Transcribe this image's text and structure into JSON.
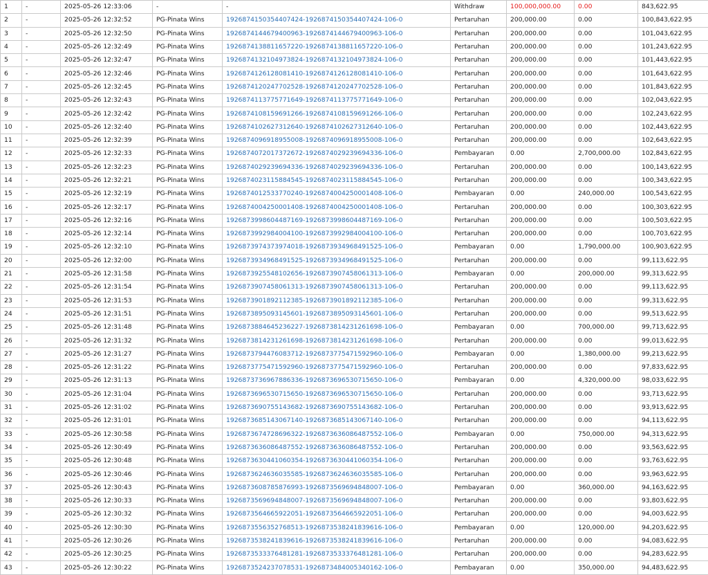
{
  "colors": {
    "link": "#2a6fb5",
    "red": "#e51616",
    "grid": "#c9c9c9"
  },
  "rows": [
    {
      "no": "1",
      "col2": "-",
      "date": "2025-05-26 12:33:06",
      "game": "-",
      "ref": "-",
      "type": "Withdraw",
      "debit": "100,000,000.00",
      "credit": "0.00",
      "balance": "843,622.95",
      "red": true
    },
    {
      "no": "2",
      "col2": "-",
      "date": "2025-05-26 12:32:52",
      "game": "PG-Pinata Wins",
      "ref": "1926874150354407424-1926874150354407424-106-0",
      "type": "Pertaruhan",
      "debit": "200,000.00",
      "credit": "0.00",
      "balance": "100,843,622.95"
    },
    {
      "no": "3",
      "col2": "-",
      "date": "2025-05-26 12:32:50",
      "game": "PG-Pinata Wins",
      "ref": "1926874144679400963-1926874144679400963-106-0",
      "type": "Pertaruhan",
      "debit": "200,000.00",
      "credit": "0.00",
      "balance": "101,043,622.95"
    },
    {
      "no": "4",
      "col2": "-",
      "date": "2025-05-26 12:32:49",
      "game": "PG-Pinata Wins",
      "ref": "1926874138811657220-1926874138811657220-106-0",
      "type": "Pertaruhan",
      "debit": "200,000.00",
      "credit": "0.00",
      "balance": "101,243,622.95"
    },
    {
      "no": "5",
      "col2": "-",
      "date": "2025-05-26 12:32:47",
      "game": "PG-Pinata Wins",
      "ref": "1926874132104973824-1926874132104973824-106-0",
      "type": "Pertaruhan",
      "debit": "200,000.00",
      "credit": "0.00",
      "balance": "101,443,622.95"
    },
    {
      "no": "6",
      "col2": "-",
      "date": "2025-05-26 12:32:46",
      "game": "PG-Pinata Wins",
      "ref": "1926874126128081410-1926874126128081410-106-0",
      "type": "Pertaruhan",
      "debit": "200,000.00",
      "credit": "0.00",
      "balance": "101,643,622.95"
    },
    {
      "no": "7",
      "col2": "-",
      "date": "2025-05-26 12:32:45",
      "game": "PG-Pinata Wins",
      "ref": "1926874120247702528-1926874120247702528-106-0",
      "type": "Pertaruhan",
      "debit": "200,000.00",
      "credit": "0.00",
      "balance": "101,843,622.95"
    },
    {
      "no": "8",
      "col2": "-",
      "date": "2025-05-26 12:32:43",
      "game": "PG-Pinata Wins",
      "ref": "1926874113775771649-1926874113775771649-106-0",
      "type": "Pertaruhan",
      "debit": "200,000.00",
      "credit": "0.00",
      "balance": "102,043,622.95"
    },
    {
      "no": "9",
      "col2": "-",
      "date": "2025-05-26 12:32:42",
      "game": "PG-Pinata Wins",
      "ref": "1926874108159691266-1926874108159691266-106-0",
      "type": "Pertaruhan",
      "debit": "200,000.00",
      "credit": "0.00",
      "balance": "102,243,622.95"
    },
    {
      "no": "10",
      "col2": "-",
      "date": "2025-05-26 12:32:40",
      "game": "PG-Pinata Wins",
      "ref": "1926874102627312640-1926874102627312640-106-0",
      "type": "Pertaruhan",
      "debit": "200,000.00",
      "credit": "0.00",
      "balance": "102,443,622.95"
    },
    {
      "no": "11",
      "col2": "-",
      "date": "2025-05-26 12:32:39",
      "game": "PG-Pinata Wins",
      "ref": "1926874096918955008-1926874096918955008-106-0",
      "type": "Pertaruhan",
      "debit": "200,000.00",
      "credit": "0.00",
      "balance": "102,643,622.95"
    },
    {
      "no": "12",
      "col2": "-",
      "date": "2025-05-26 12:32:33",
      "game": "PG-Pinata Wins",
      "ref": "1926874072017372672-1926874029239694336-106-0",
      "type": "Pembayaran",
      "debit": "0.00",
      "credit": "2,700,000.00",
      "balance": "102,843,622.95"
    },
    {
      "no": "13",
      "col2": "-",
      "date": "2025-05-26 12:32:23",
      "game": "PG-Pinata Wins",
      "ref": "1926874029239694336-1926874029239694336-106-0",
      "type": "Pertaruhan",
      "debit": "200,000.00",
      "credit": "0.00",
      "balance": "100,143,622.95"
    },
    {
      "no": "14",
      "col2": "-",
      "date": "2025-05-26 12:32:21",
      "game": "PG-Pinata Wins",
      "ref": "1926874023115884545-1926874023115884545-106-0",
      "type": "Pertaruhan",
      "debit": "200,000.00",
      "credit": "0.00",
      "balance": "100,343,622.95"
    },
    {
      "no": "15",
      "col2": "-",
      "date": "2025-05-26 12:32:19",
      "game": "PG-Pinata Wins",
      "ref": "1926874012533770240-1926874004250001408-106-0",
      "type": "Pembayaran",
      "debit": "0.00",
      "credit": "240,000.00",
      "balance": "100,543,622.95"
    },
    {
      "no": "16",
      "col2": "-",
      "date": "2025-05-26 12:32:17",
      "game": "PG-Pinata Wins",
      "ref": "1926874004250001408-1926874004250001408-106-0",
      "type": "Pertaruhan",
      "debit": "200,000.00",
      "credit": "0.00",
      "balance": "100,303,622.95"
    },
    {
      "no": "17",
      "col2": "-",
      "date": "2025-05-26 12:32:16",
      "game": "PG-Pinata Wins",
      "ref": "1926873998604487169-1926873998604487169-106-0",
      "type": "Pertaruhan",
      "debit": "200,000.00",
      "credit": "0.00",
      "balance": "100,503,622.95"
    },
    {
      "no": "18",
      "col2": "-",
      "date": "2025-05-26 12:32:14",
      "game": "PG-Pinata Wins",
      "ref": "1926873992984004100-1926873992984004100-106-0",
      "type": "Pertaruhan",
      "debit": "200,000.00",
      "credit": "0.00",
      "balance": "100,703,622.95"
    },
    {
      "no": "19",
      "col2": "-",
      "date": "2025-05-26 12:32:10",
      "game": "PG-Pinata Wins",
      "ref": "1926873974373974018-1926873934968491525-106-0",
      "type": "Pembayaran",
      "debit": "0.00",
      "credit": "1,790,000.00",
      "balance": "100,903,622.95"
    },
    {
      "no": "20",
      "col2": "-",
      "date": "2025-05-26 12:32:00",
      "game": "PG-Pinata Wins",
      "ref": "1926873934968491525-1926873934968491525-106-0",
      "type": "Pertaruhan",
      "debit": "200,000.00",
      "credit": "0.00",
      "balance": "99,113,622.95"
    },
    {
      "no": "21",
      "col2": "-",
      "date": "2025-05-26 12:31:58",
      "game": "PG-Pinata Wins",
      "ref": "1926873925548102656-1926873907458061313-106-0",
      "type": "Pembayaran",
      "debit": "0.00",
      "credit": "200,000.00",
      "balance": "99,313,622.95"
    },
    {
      "no": "22",
      "col2": "-",
      "date": "2025-05-26 12:31:54",
      "game": "PG-Pinata Wins",
      "ref": "1926873907458061313-1926873907458061313-106-0",
      "type": "Pertaruhan",
      "debit": "200,000.00",
      "credit": "0.00",
      "balance": "99,113,622.95"
    },
    {
      "no": "23",
      "col2": "-",
      "date": "2025-05-26 12:31:53",
      "game": "PG-Pinata Wins",
      "ref": "1926873901892112385-1926873901892112385-106-0",
      "type": "Pertaruhan",
      "debit": "200,000.00",
      "credit": "0.00",
      "balance": "99,313,622.95"
    },
    {
      "no": "24",
      "col2": "-",
      "date": "2025-05-26 12:31:51",
      "game": "PG-Pinata Wins",
      "ref": "1926873895093145601-1926873895093145601-106-0",
      "type": "Pertaruhan",
      "debit": "200,000.00",
      "credit": "0.00",
      "balance": "99,513,622.95"
    },
    {
      "no": "25",
      "col2": "-",
      "date": "2025-05-26 12:31:48",
      "game": "PG-Pinata Wins",
      "ref": "1926873884645236227-1926873814231261698-106-0",
      "type": "Pembayaran",
      "debit": "0.00",
      "credit": "700,000.00",
      "balance": "99,713,622.95"
    },
    {
      "no": "26",
      "col2": "-",
      "date": "2025-05-26 12:31:32",
      "game": "PG-Pinata Wins",
      "ref": "1926873814231261698-1926873814231261698-106-0",
      "type": "Pertaruhan",
      "debit": "200,000.00",
      "credit": "0.00",
      "balance": "99,013,622.95"
    },
    {
      "no": "27",
      "col2": "-",
      "date": "2025-05-26 12:31:27",
      "game": "PG-Pinata Wins",
      "ref": "1926873794476083712-1926873775471592960-106-0",
      "type": "Pembayaran",
      "debit": "0.00",
      "credit": "1,380,000.00",
      "balance": "99,213,622.95"
    },
    {
      "no": "28",
      "col2": "-",
      "date": "2025-05-26 12:31:22",
      "game": "PG-Pinata Wins",
      "ref": "1926873775471592960-1926873775471592960-106-0",
      "type": "Pertaruhan",
      "debit": "200,000.00",
      "credit": "0.00",
      "balance": "97,833,622.95"
    },
    {
      "no": "29",
      "col2": "-",
      "date": "2025-05-26 12:31:13",
      "game": "PG-Pinata Wins",
      "ref": "1926873736967886336-1926873696530715650-106-0",
      "type": "Pembayaran",
      "debit": "0.00",
      "credit": "4,320,000.00",
      "balance": "98,033,622.95"
    },
    {
      "no": "30",
      "col2": "-",
      "date": "2025-05-26 12:31:04",
      "game": "PG-Pinata Wins",
      "ref": "1926873696530715650-1926873696530715650-106-0",
      "type": "Pertaruhan",
      "debit": "200,000.00",
      "credit": "0.00",
      "balance": "93,713,622.95"
    },
    {
      "no": "31",
      "col2": "-",
      "date": "2025-05-26 12:31:02",
      "game": "PG-Pinata Wins",
      "ref": "1926873690755143682-1926873690755143682-106-0",
      "type": "Pertaruhan",
      "debit": "200,000.00",
      "credit": "0.00",
      "balance": "93,913,622.95"
    },
    {
      "no": "32",
      "col2": "-",
      "date": "2025-05-26 12:31:01",
      "game": "PG-Pinata Wins",
      "ref": "1926873685143067140-1926873685143067140-106-0",
      "type": "Pertaruhan",
      "debit": "200,000.00",
      "credit": "0.00",
      "balance": "94,113,622.95"
    },
    {
      "no": "33",
      "col2": "-",
      "date": "2025-05-26 12:30:58",
      "game": "PG-Pinata Wins",
      "ref": "1926873674728696322-1926873636086487552-106-0",
      "type": "Pembayaran",
      "debit": "0.00",
      "credit": "750,000.00",
      "balance": "94,313,622.95"
    },
    {
      "no": "34",
      "col2": "-",
      "date": "2025-05-26 12:30:49",
      "game": "PG-Pinata Wins",
      "ref": "1926873636086487552-1926873636086487552-106-0",
      "type": "Pertaruhan",
      "debit": "200,000.00",
      "credit": "0.00",
      "balance": "93,563,622.95"
    },
    {
      "no": "35",
      "col2": "-",
      "date": "2025-05-26 12:30:48",
      "game": "PG-Pinata Wins",
      "ref": "1926873630441060354-1926873630441060354-106-0",
      "type": "Pertaruhan",
      "debit": "200,000.00",
      "credit": "0.00",
      "balance": "93,763,622.95"
    },
    {
      "no": "36",
      "col2": "-",
      "date": "2025-05-26 12:30:46",
      "game": "PG-Pinata Wins",
      "ref": "1926873624636035585-1926873624636035585-106-0",
      "type": "Pertaruhan",
      "debit": "200,000.00",
      "credit": "0.00",
      "balance": "93,963,622.95"
    },
    {
      "no": "37",
      "col2": "-",
      "date": "2025-05-26 12:30:43",
      "game": "PG-Pinata Wins",
      "ref": "1926873608785876993-1926873569694848007-106-0",
      "type": "Pembayaran",
      "debit": "0.00",
      "credit": "360,000.00",
      "balance": "94,163,622.95"
    },
    {
      "no": "38",
      "col2": "-",
      "date": "2025-05-26 12:30:33",
      "game": "PG-Pinata Wins",
      "ref": "1926873569694848007-1926873569694848007-106-0",
      "type": "Pertaruhan",
      "debit": "200,000.00",
      "credit": "0.00",
      "balance": "93,803,622.95"
    },
    {
      "no": "39",
      "col2": "-",
      "date": "2025-05-26 12:30:32",
      "game": "PG-Pinata Wins",
      "ref": "1926873564665922051-1926873564665922051-106-0",
      "type": "Pertaruhan",
      "debit": "200,000.00",
      "credit": "0.00",
      "balance": "94,003,622.95"
    },
    {
      "no": "40",
      "col2": "-",
      "date": "2025-05-26 12:30:30",
      "game": "PG-Pinata Wins",
      "ref": "1926873556352768513-1926873538241839616-106-0",
      "type": "Pembayaran",
      "debit": "0.00",
      "credit": "120,000.00",
      "balance": "94,203,622.95"
    },
    {
      "no": "41",
      "col2": "-",
      "date": "2025-05-26 12:30:26",
      "game": "PG-Pinata Wins",
      "ref": "1926873538241839616-1926873538241839616-106-0",
      "type": "Pertaruhan",
      "debit": "200,000.00",
      "credit": "0.00",
      "balance": "94,083,622.95"
    },
    {
      "no": "42",
      "col2": "-",
      "date": "2025-05-26 12:30:25",
      "game": "PG-Pinata Wins",
      "ref": "1926873533376481281-1926873533376481281-106-0",
      "type": "Pertaruhan",
      "debit": "200,000.00",
      "credit": "0.00",
      "balance": "94,283,622.95"
    },
    {
      "no": "43",
      "col2": "-",
      "date": "2025-05-26 12:30:22",
      "game": "PG-Pinata Wins",
      "ref": "1926873524237078531-1926873484005340162-106-0",
      "type": "Pembayaran",
      "debit": "0.00",
      "credit": "350,000.00",
      "balance": "94,483,622.95"
    }
  ]
}
